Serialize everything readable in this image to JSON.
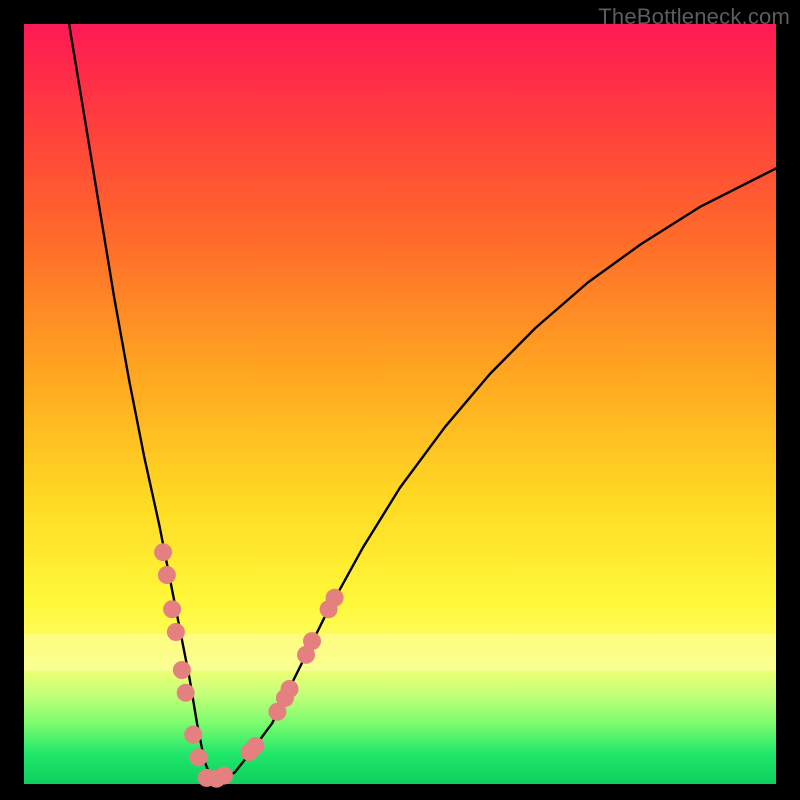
{
  "watermark": "TheBottleneck.com",
  "chart_data": {
    "type": "line",
    "title": "",
    "xlabel": "",
    "ylabel": "",
    "xlim": [
      0,
      100
    ],
    "ylim": [
      0,
      100
    ],
    "grid": false,
    "legend": false,
    "series": [
      {
        "name": "bottleneck-curve",
        "x": [
          6,
          8,
          10,
          12,
          14,
          16,
          18,
          20,
          22,
          23,
          24,
          25,
          26,
          28,
          30,
          33,
          36,
          40,
          45,
          50,
          56,
          62,
          68,
          75,
          82,
          90,
          100
        ],
        "y": [
          100,
          88,
          76,
          64,
          53,
          43,
          34,
          24,
          14,
          8,
          3,
          0.5,
          0.5,
          1.5,
          4,
          8,
          14,
          22,
          31,
          39,
          47,
          54,
          60,
          66,
          71,
          76,
          81
        ]
      }
    ],
    "markers": {
      "name": "segment-dots",
      "color": "#e58080",
      "points": [
        {
          "x": 18.5,
          "y": 30.5
        },
        {
          "x": 19.0,
          "y": 27.5
        },
        {
          "x": 19.7,
          "y": 23.0
        },
        {
          "x": 20.2,
          "y": 20.0
        },
        {
          "x": 21.0,
          "y": 15.0
        },
        {
          "x": 21.5,
          "y": 12.0
        },
        {
          "x": 22.5,
          "y": 6.5
        },
        {
          "x": 23.2,
          "y": 3.5
        },
        {
          "x": 24.3,
          "y": 0.8
        },
        {
          "x": 25.6,
          "y": 0.7
        },
        {
          "x": 26.6,
          "y": 1.1
        },
        {
          "x": 30.0,
          "y": 4.2
        },
        {
          "x": 30.8,
          "y": 5.0
        },
        {
          "x": 33.7,
          "y": 9.5
        },
        {
          "x": 34.7,
          "y": 11.3
        },
        {
          "x": 35.3,
          "y": 12.5
        },
        {
          "x": 37.5,
          "y": 17.0
        },
        {
          "x": 38.3,
          "y": 18.8
        },
        {
          "x": 40.5,
          "y": 23.0
        },
        {
          "x": 41.3,
          "y": 24.5
        }
      ]
    },
    "gradient_stops": [
      {
        "pos": 0,
        "color": "#ff1a55"
      },
      {
        "pos": 28,
        "color": "#ff6a2a"
      },
      {
        "pos": 62,
        "color": "#ffd822"
      },
      {
        "pos": 84,
        "color": "#fbff6d"
      },
      {
        "pos": 100,
        "color": "#0ecf5f"
      }
    ]
  }
}
